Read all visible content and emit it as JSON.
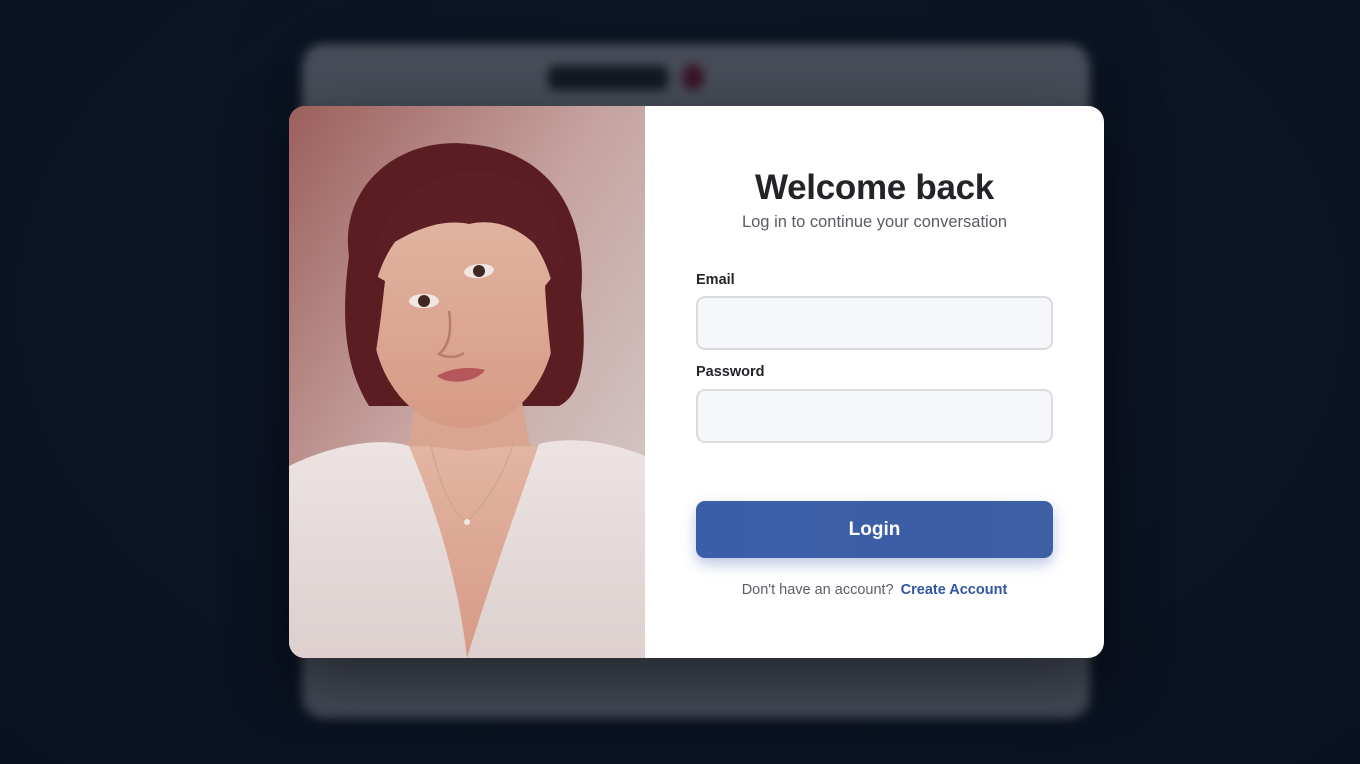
{
  "login": {
    "title": "Welcome back",
    "subtitle": "Log in to continue your conversation",
    "email_label": "Email",
    "email_value": "",
    "password_label": "Password",
    "password_value": "",
    "login_button": "Login",
    "signup_prompt": "Don't have an account?",
    "signup_link": "Create Account"
  },
  "colors": {
    "accent": "#3a5fa8",
    "link": "#2f56a3",
    "background": "#131d33"
  }
}
